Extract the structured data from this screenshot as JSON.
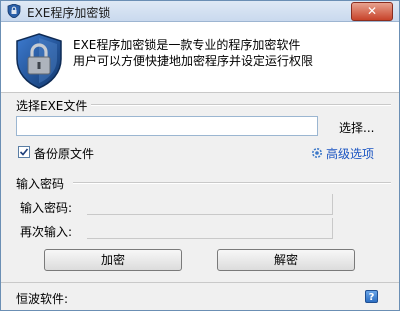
{
  "window": {
    "title": "EXE程序加密锁",
    "close_label": "✕"
  },
  "header": {
    "line1": "EXE程序加密锁是一款专业的程序加密软件",
    "line2": "用户可以方便快捷地加密程序并设定运行权限"
  },
  "file_group": {
    "label": "选择EXE文件",
    "file_value": "",
    "browse_label": "选择...",
    "backup_label": "备份原文件",
    "backup_checked": true,
    "advanced_label": "高级选项"
  },
  "password_group": {
    "label": "输入密码",
    "password_label": "输入密码:",
    "repeat_label": "再次输入:"
  },
  "buttons": {
    "encrypt": "加密",
    "decrypt": "解密"
  },
  "footer": {
    "text": "恒波软件:",
    "help": "?"
  }
}
